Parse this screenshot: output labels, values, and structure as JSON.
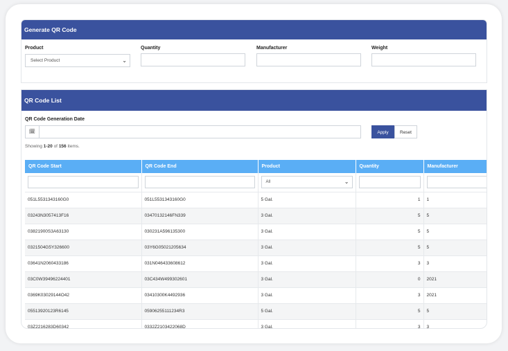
{
  "generate": {
    "title": "Generate QR Code",
    "product_label": "Product",
    "product_selected": "Select Product",
    "quantity_label": "Quantity",
    "manufacturer_label": "Manufacturer",
    "weight_label": "Weight"
  },
  "list": {
    "title": "QR Code List",
    "date_label": "QR Code Generation Date",
    "apply_label": "Apply",
    "reset_label": "Reset",
    "summary_prefix": "Showing ",
    "summary_range": "1-20",
    "summary_mid": " of ",
    "summary_total": "156",
    "summary_suffix": " items.",
    "product_filter_selected": "All",
    "columns": [
      "QR Code Start",
      "QR Code End",
      "Product",
      "Quantity",
      "Manufacturer"
    ],
    "rows": [
      [
        "051L5531343160G0",
        "051L5531343160G0",
        "5 Gal.",
        "1",
        "1"
      ],
      [
        "03243N3057413F16",
        "03470132146FN339",
        "3 Gal.",
        "5",
        "5"
      ],
      [
        "03821900S3A63130",
        "030231A596135300",
        "3 Gal.",
        "5",
        "5"
      ],
      [
        "0321504G5Y326600",
        "03Y6G05021205634",
        "3 Gal.",
        "5",
        "5"
      ],
      [
        "03641N2060433186",
        "031N046433608612",
        "3 Gal.",
        "3",
        "3"
      ],
      [
        "03C0W39496224401",
        "03C434W499302601",
        "3 Gal.",
        "0",
        "2021"
      ],
      [
        "0369K03029144O42",
        "03410300K4492936",
        "3 Gal.",
        "3",
        "2021"
      ],
      [
        "05513920123R6145",
        "05906255111234R3",
        "5 Gal.",
        "5",
        "5"
      ],
      [
        "03Z2216283D60342",
        "0332Z2103422068D",
        "3 Gal.",
        "3",
        "3"
      ]
    ]
  },
  "icons": {
    "calendar": "calendar-icon",
    "chevron": "chevron-down-icon"
  },
  "colors": {
    "header": "#3a529e",
    "table_header": "#5aaef5",
    "apply": "#3a529e"
  }
}
